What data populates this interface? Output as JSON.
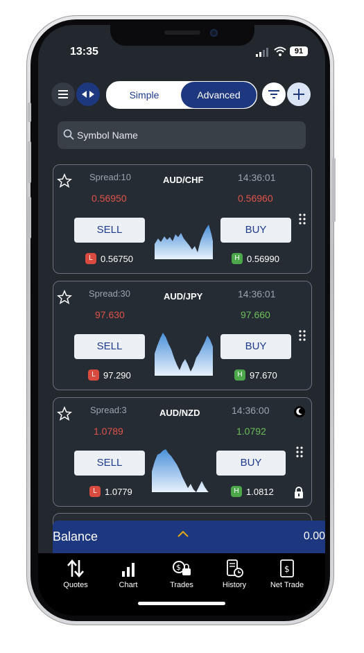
{
  "status": {
    "time": "13:35",
    "battery": "91"
  },
  "toolbar": {
    "simple_label": "Simple",
    "advanced_label": "Advanced",
    "selected": "Advanced"
  },
  "search": {
    "placeholder": "Symbol Name"
  },
  "quotes": [
    {
      "symbol": "AUD/CHF",
      "spread": "Spread:10",
      "time": "14:36:01",
      "bid": "0.56950",
      "ask": "0.56960",
      "bid_color": "red",
      "ask_color": "red",
      "sell_label": "SELL",
      "buy_label": "BUY",
      "low_badge": "L",
      "low": "0.56750",
      "high_badge": "H",
      "high": "0.56990",
      "market_closed": false
    },
    {
      "symbol": "AUD/JPY",
      "spread": "Spread:30",
      "time": "14:36:01",
      "bid": "97.630",
      "ask": "97.660",
      "bid_color": "red",
      "ask_color": "green",
      "sell_label": "SELL",
      "buy_label": "BUY",
      "low_badge": "L",
      "low": "97.290",
      "high_badge": "H",
      "high": "97.670",
      "market_closed": false
    },
    {
      "symbol": "AUD/NZD",
      "spread": "Spread:3",
      "time": "14:36:00",
      "bid": "1.0789",
      "ask": "1.0792",
      "bid_color": "red",
      "ask_color": "green",
      "sell_label": "SELL",
      "buy_label": "BUY",
      "low_badge": "L",
      "low": "1.0779",
      "high_badge": "H",
      "high": "1.0812",
      "market_closed": true
    }
  ],
  "balance": {
    "label": "Balance",
    "value": "0.00"
  },
  "tabs": [
    {
      "label": "Quotes",
      "icon": "sort-arrows-icon"
    },
    {
      "label": "Chart",
      "icon": "bar-chart-icon"
    },
    {
      "label": "Trades",
      "icon": "trades-icon"
    },
    {
      "label": "History",
      "icon": "history-icon"
    },
    {
      "label": "Net Trade",
      "icon": "net-trade-icon"
    }
  ],
  "colors": {
    "accent": "#1e3880",
    "background": "#23282f",
    "card": "#262c34",
    "red": "#e0534a",
    "green": "#6bbf59"
  }
}
